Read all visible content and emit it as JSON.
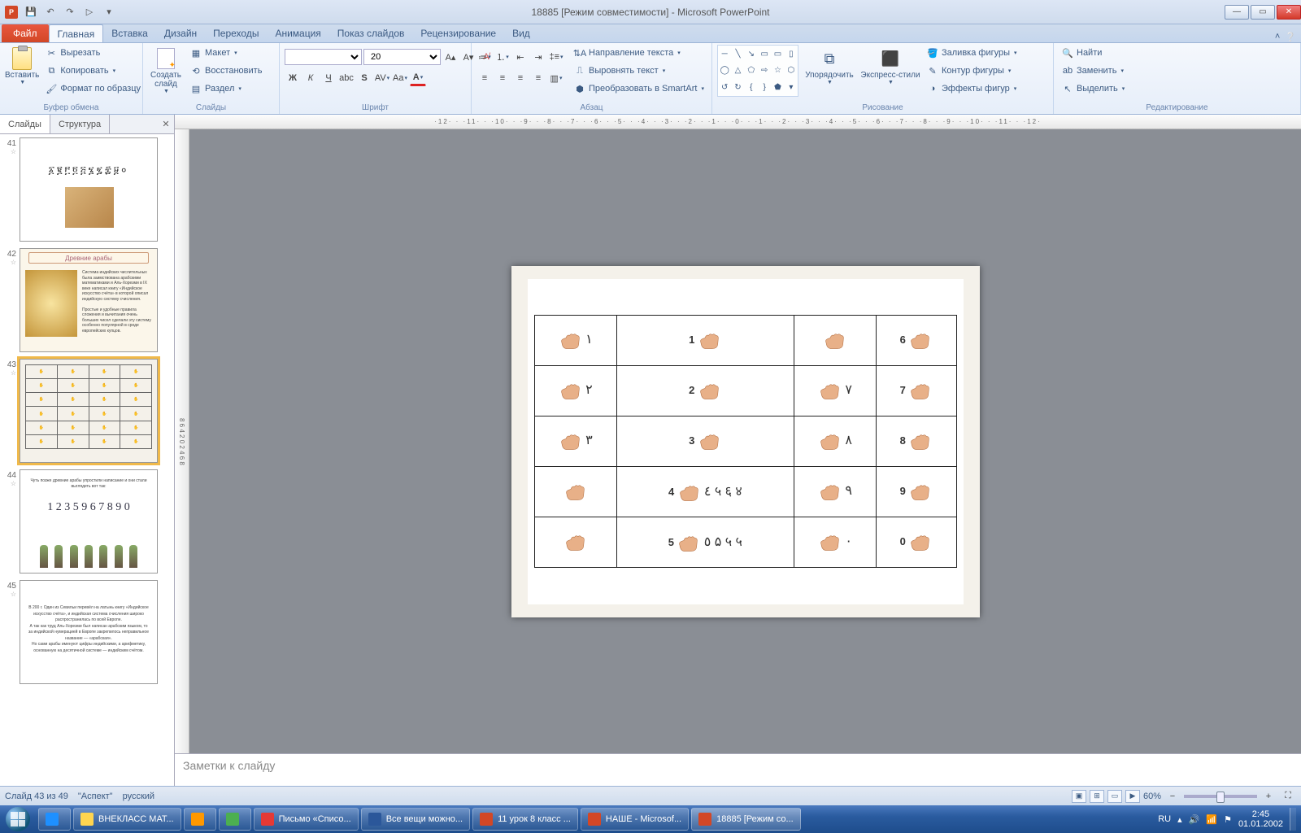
{
  "title": "18885 [Режим совместимости] - Microsoft PowerPoint",
  "qat": {
    "save": "💾",
    "undo": "↶",
    "redo": "↷",
    "play": "▷"
  },
  "tabs": {
    "file": "Файл",
    "list": [
      "Главная",
      "Вставка",
      "Дизайн",
      "Переходы",
      "Анимация",
      "Показ слайдов",
      "Рецензирование",
      "Вид"
    ],
    "active": "Главная"
  },
  "ribbon": {
    "clipboard": {
      "label": "Буфер обмена",
      "paste": "Вставить",
      "cut": "Вырезать",
      "copy": "Копировать",
      "format_painter": "Формат по образцу"
    },
    "slides": {
      "label": "Слайды",
      "new_slide": "Создать слайд",
      "layout": "Макет",
      "reset": "Восстановить",
      "section": "Раздел"
    },
    "font": {
      "label": "Шрифт",
      "size": "20"
    },
    "paragraph": {
      "label": "Абзац",
      "text_direction": "Направление текста",
      "align_text": "Выровнять текст",
      "smartart": "Преобразовать в SmartArt"
    },
    "drawing": {
      "label": "Рисование",
      "arrange": "Упорядочить",
      "quick_styles": "Экспресс-стили",
      "fill": "Заливка фигуры",
      "outline": "Контур фигуры",
      "effects": "Эффекты фигур"
    },
    "editing": {
      "label": "Редактирование",
      "find": "Найти",
      "replace": "Заменить",
      "select": "Выделить"
    }
  },
  "side": {
    "tabs": {
      "slides": "Слайды",
      "outline": "Структура"
    },
    "thumbs": [
      {
        "n": 41,
        "kind": "numerals"
      },
      {
        "n": 42,
        "kind": "arabs",
        "title": "Древние арабы"
      },
      {
        "n": 43,
        "kind": "grid",
        "selected": true
      },
      {
        "n": 44,
        "kind": "digits",
        "digits": "1 2 3 5 9 6 7 8 9 0"
      },
      {
        "n": 45,
        "kind": "text"
      }
    ]
  },
  "slide": {
    "rows": [
      [
        {
          "sym": "١",
          "d": ""
        },
        {
          "sym": "",
          "d": "1"
        },
        {
          "sym": "",
          "d": ""
        },
        {
          "sym": "",
          "d": "6"
        }
      ],
      [
        {
          "sym": "٢",
          "d": ""
        },
        {
          "sym": "",
          "d": "2"
        },
        {
          "sym": "٧",
          "d": ""
        },
        {
          "sym": "",
          "d": "7"
        }
      ],
      [
        {
          "sym": "٣",
          "d": ""
        },
        {
          "sym": "",
          "d": "3"
        },
        {
          "sym": "٨",
          "d": ""
        },
        {
          "sym": "",
          "d": "8"
        }
      ],
      [
        {
          "sym": "",
          "d": ""
        },
        {
          "sym": "٤ ५ ६ ४",
          "d": "4"
        },
        {
          "sym": "٩",
          "d": ""
        },
        {
          "sym": "",
          "d": "9"
        }
      ],
      [
        {
          "sym": "",
          "d": ""
        },
        {
          "sym": "٥ ۵ ५ ५",
          "d": "5"
        },
        {
          "sym": "٠",
          "d": ""
        },
        {
          "sym": "",
          "d": "0"
        }
      ]
    ]
  },
  "notes_placeholder": "Заметки к слайду",
  "status": {
    "slide": "Слайд 43 из 49",
    "theme": "\"Аспект\"",
    "lang": "русский",
    "zoom": "60%"
  },
  "taskbar": {
    "items": [
      {
        "icon": "#1e90ff",
        "label": ""
      },
      {
        "icon": "#ffd54f",
        "label": "ВНЕКЛАСС МАТ..."
      },
      {
        "icon": "#ff9800",
        "label": ""
      },
      {
        "icon": "#4caf50",
        "label": ""
      },
      {
        "icon": "#e53935",
        "label": "Письмо «Списо..."
      },
      {
        "icon": "#2b579a",
        "label": "Все вещи можно..."
      },
      {
        "icon": "#d24726",
        "label": "11 урок  8 класс ..."
      },
      {
        "icon": "#d24726",
        "label": "НАШЕ - Microsof..."
      },
      {
        "icon": "#d24726",
        "label": "18885 [Режим со...",
        "active": true
      }
    ],
    "lang": "RU",
    "time": "2:45",
    "date": "01.01.2002"
  },
  "ruler_ticks": "·12· · ·11· · ·10· · ·9· · ·8· · ·7· · ·6· · ·5· · ·4· · ·3· · ·2· · ·1· · ·0· · ·1· · ·2· · ·3· · ·4· · ·5· · ·6· · ·7· · ·8· · ·9· · ·10· · ·11· · ·12·"
}
